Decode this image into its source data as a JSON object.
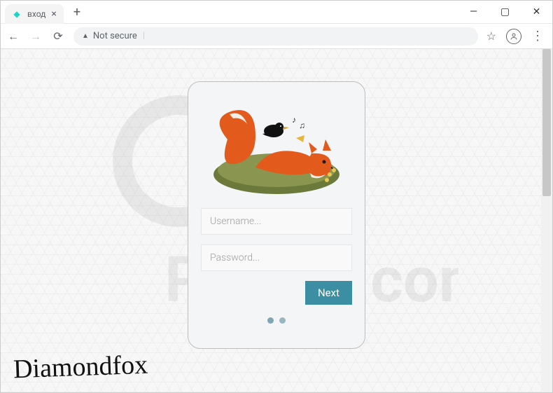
{
  "window": {
    "tab_title": "вход",
    "address_status": "Not secure",
    "minimize_glyph": "—",
    "maximize_glyph": "▢",
    "close_glyph": "✕"
  },
  "login": {
    "username_placeholder": "Username...",
    "password_placeholder": "Password...",
    "next_label": "Next"
  },
  "branding": {
    "signature": "Diamondfox",
    "watermark_text": "PCrisk.com"
  },
  "icons": {
    "back": "←",
    "forward": "→",
    "reload": "⟳",
    "warning": "▲",
    "star": "☆",
    "profile": "◯",
    "menu": "⋮",
    "newtab": "+",
    "tabclose": "×",
    "favicon": "◆"
  },
  "colors": {
    "accent": "#3c8ea3",
    "card_bg": "#f4f5f7",
    "card_border": "#bdbdbd",
    "dot": "#7fa6b2",
    "favicon": "#1bd6c4"
  }
}
